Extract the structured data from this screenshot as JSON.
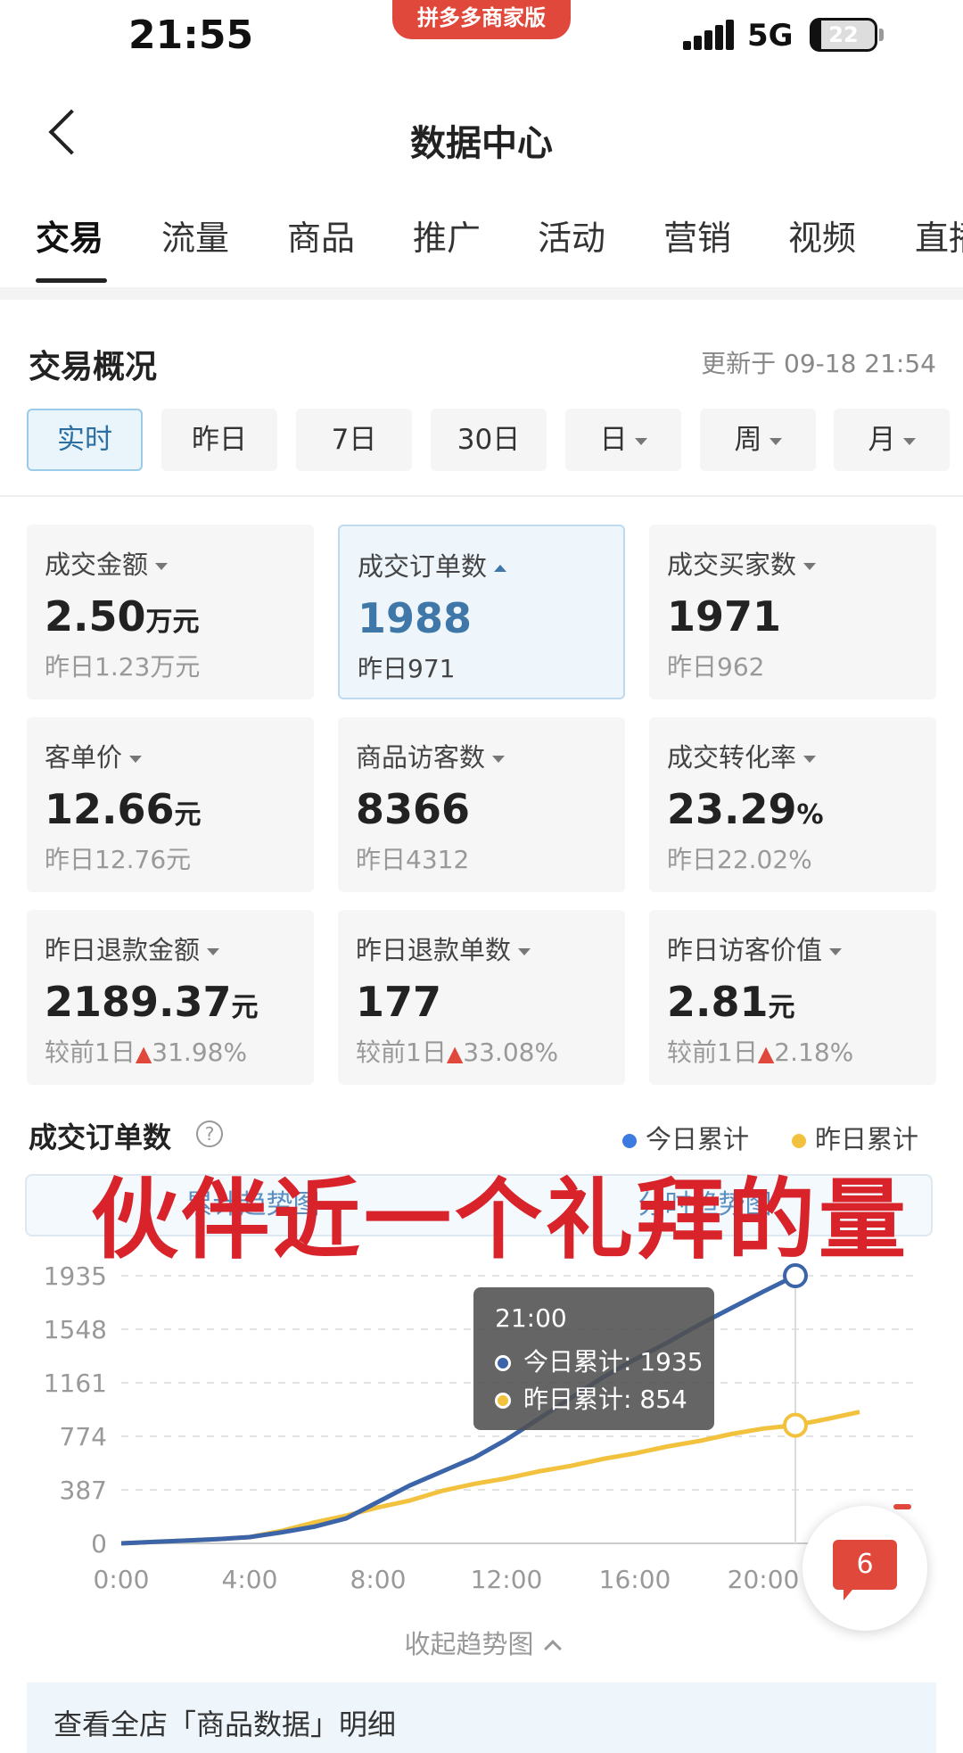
{
  "status_bar": {
    "time": "21:55",
    "app_badge": "拼多多商家版",
    "network": "5G",
    "battery": "22"
  },
  "header": {
    "title": "数据中心"
  },
  "tabs": [
    "交易",
    "流量",
    "商品",
    "推广",
    "活动",
    "营销",
    "视频",
    "直播"
  ],
  "overview": {
    "title": "交易概况",
    "update_time": "更新于 09-18 21:54",
    "ranges": [
      "实时",
      "昨日",
      "7日",
      "30日",
      "日",
      "周",
      "月"
    ]
  },
  "metrics": [
    {
      "label": "成交金额",
      "value": "2.50",
      "unit": "万元",
      "sub": "昨日1.23万元"
    },
    {
      "label": "成交订单数",
      "value": "1988",
      "unit": "",
      "sub": "昨日971"
    },
    {
      "label": "成交买家数",
      "value": "1971",
      "unit": "",
      "sub": "昨日962"
    },
    {
      "label": "客单价",
      "value": "12.66",
      "unit": "元",
      "sub": "昨日12.76元"
    },
    {
      "label": "商品访客数",
      "value": "8366",
      "unit": "",
      "sub": "昨日4312"
    },
    {
      "label": "成交转化率",
      "value": "23.29",
      "unit": "%",
      "sub": "昨日22.02%"
    },
    {
      "label": "昨日退款金额",
      "value": "2189.37",
      "unit": "元",
      "sub_prefix": "较前1日",
      "change": "31.98%"
    },
    {
      "label": "昨日退款单数",
      "value": "177",
      "unit": "",
      "sub_prefix": "较前1日",
      "change": "33.08%"
    },
    {
      "label": "昨日访客价值",
      "value": "2.81",
      "unit": "元",
      "sub_prefix": "较前1日",
      "change": "2.18%"
    }
  ],
  "chart_section": {
    "title": "成交订单数",
    "legend": [
      "今日累计",
      "昨日累计"
    ],
    "toggle": [
      "累计趋势图",
      "分时趋势图"
    ],
    "watermark": "伙伴近一个礼拜的量",
    "collapse_label": "收起趋势图",
    "tooltip": {
      "time": "21:00",
      "today": "今日累计: 1935",
      "yesterday": "昨日累计: 854"
    }
  },
  "chart_data": {
    "type": "line",
    "x_labels": [
      "0:00",
      "4:00",
      "8:00",
      "12:00",
      "16:00",
      "20:00"
    ],
    "y_ticks": [
      0,
      387,
      774,
      1161,
      1548,
      1935
    ],
    "ylim": [
      0,
      1935
    ],
    "xlim": [
      0,
      24
    ],
    "colors": {
      "today": "#3c64a8",
      "yesterday": "#f2c23f"
    },
    "series": [
      {
        "name": "今日累计",
        "x": [
          0,
          1,
          2,
          3,
          4,
          5,
          6,
          7,
          8,
          9,
          10,
          11,
          12,
          13,
          14,
          15,
          16,
          17,
          18,
          19,
          20,
          21
        ],
        "values": [
          0,
          10,
          20,
          30,
          45,
          80,
          120,
          180,
          300,
          420,
          520,
          620,
          750,
          900,
          1050,
          1200,
          1330,
          1450,
          1580,
          1700,
          1820,
          1935
        ]
      },
      {
        "name": "昨日累计",
        "x": [
          0,
          1,
          2,
          3,
          4,
          5,
          6,
          7,
          8,
          9,
          10,
          11,
          12,
          13,
          14,
          15,
          16,
          17,
          18,
          19,
          20,
          21,
          22,
          23
        ],
        "values": [
          0,
          10,
          20,
          30,
          45,
          90,
          150,
          200,
          260,
          310,
          380,
          430,
          470,
          520,
          560,
          610,
          650,
          700,
          740,
          790,
          830,
          854,
          900,
          950
        ]
      }
    ]
  },
  "messages": {
    "count": "6"
  },
  "footer": {
    "detail": "查看全店「商品数据」明细"
  }
}
